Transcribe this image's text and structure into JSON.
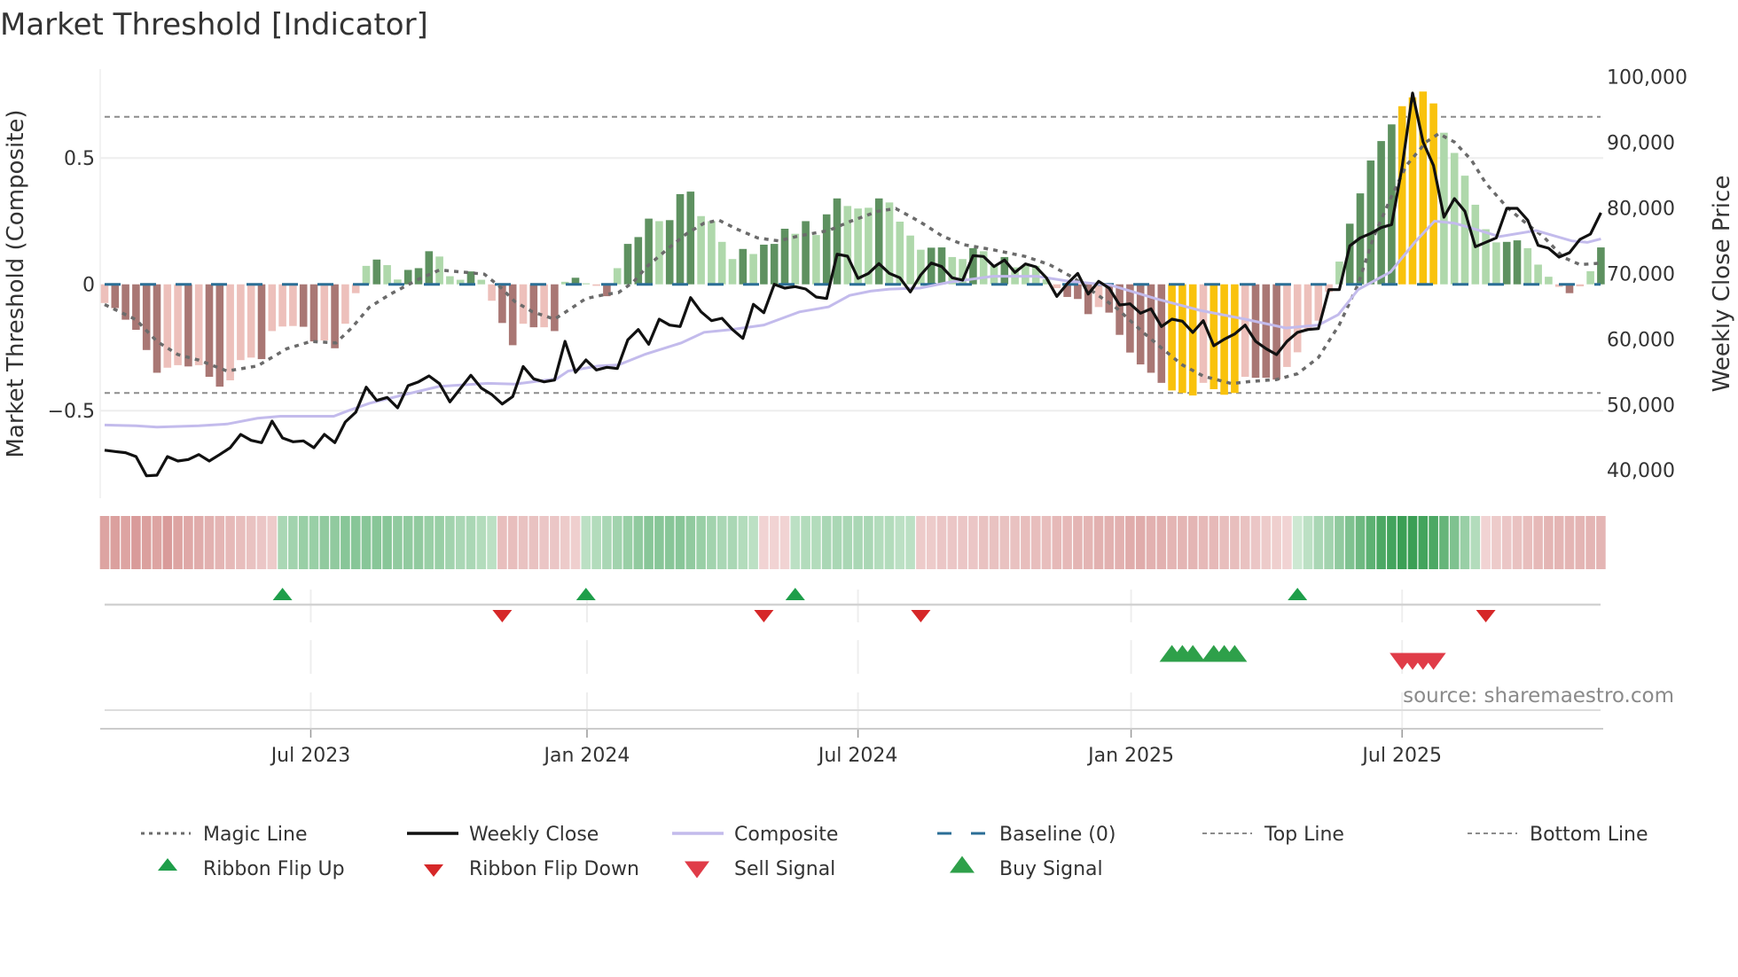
{
  "title": "Market Threshold [Indicator]",
  "source": "source: sharemaestro.com",
  "chart_data": {
    "type": "bar",
    "title": "Market Threshold [Indicator]",
    "ylabel_left": "Market Threshold (Composite)",
    "ylabel_right": "Weekly Close Price",
    "ylim_left": [
      -0.85,
      0.85
    ],
    "ylim_right": [
      35700,
      100900
    ],
    "top_line": 0.663,
    "bottom_line": -0.43,
    "baseline": 0,
    "grid": true,
    "legend_placement": "bottom",
    "x_unit": "week index",
    "x_ticks": [
      {
        "label": "Jul 2023",
        "week": 19.7
      },
      {
        "label": "Jan 2024",
        "week": 46.1
      },
      {
        "label": "Jul 2024",
        "week": 72
      },
      {
        "label": "Jan 2025",
        "week": 98.1
      },
      {
        "label": "Jul 2025",
        "week": 124
      }
    ],
    "y_left_ticks": [
      {
        "label": "0.5",
        "value": 0.5
      },
      {
        "label": "0",
        "value": 0
      },
      {
        "label": "−0.5",
        "value": -0.5
      }
    ],
    "y_right_ticks": [
      {
        "label": "100,000",
        "value": 100000
      },
      {
        "label": "90,000",
        "value": 90000
      },
      {
        "label": "80,000",
        "value": 80000
      },
      {
        "label": "70,000",
        "value": 70000
      },
      {
        "label": "60,000",
        "value": 60000
      },
      {
        "label": "50,000",
        "value": 50000
      },
      {
        "label": "40,000",
        "value": 40000
      }
    ],
    "histogram": [
      -0.074,
      -0.094,
      -0.14,
      -0.18,
      -0.26,
      -0.35,
      -0.33,
      -0.32,
      -0.325,
      -0.32,
      -0.366,
      -0.405,
      -0.38,
      -0.3,
      -0.29,
      -0.296,
      -0.185,
      -0.167,
      -0.165,
      -0.168,
      -0.226,
      -0.222,
      -0.253,
      -0.156,
      -0.035,
      0.073,
      0.098,
      0.076,
      0.019,
      0.057,
      0.064,
      0.131,
      0.11,
      0.032,
      0.018,
      0.051,
      0.018,
      -0.065,
      -0.153,
      -0.241,
      -0.156,
      -0.17,
      -0.17,
      -0.185,
      0.01,
      0.026,
      0.004,
      -0.006,
      -0.047,
      0.064,
      0.16,
      0.187,
      0.26,
      0.25,
      0.254,
      0.357,
      0.367,
      0.27,
      0.25,
      0.168,
      0.1,
      0.14,
      0.12,
      0.157,
      0.16,
      0.22,
      0.2,
      0.25,
      0.195,
      0.277,
      0.34,
      0.31,
      0.3,
      0.303,
      0.34,
      0.324,
      0.248,
      0.193,
      0.137,
      0.145,
      0.146,
      0.108,
      0.1,
      0.143,
      0.131,
      0.073,
      0.108,
      0.067,
      0.073,
      0.073,
      0.02,
      -0.015,
      -0.05,
      -0.058,
      -0.118,
      -0.09,
      -0.112,
      -0.2,
      -0.27,
      -0.317,
      -0.35,
      -0.39,
      -0.42,
      -0.43,
      -0.44,
      -0.39,
      -0.415,
      -0.437,
      -0.43,
      -0.366,
      -0.37,
      -0.37,
      -0.377,
      -0.327,
      -0.269,
      -0.179,
      -0.144,
      -0.03,
      0.09,
      0.24,
      0.36,
      0.49,
      0.567,
      0.633,
      0.705,
      0.74,
      0.763,
      0.716,
      0.6,
      0.52,
      0.43,
      0.315,
      0.218,
      0.166,
      0.168,
      0.174,
      0.143,
      0.078,
      0.03,
      -0.01,
      -0.035,
      -0.008,
      0.052,
      0.146
    ],
    "histogram_state": "rRRRRRrrRrRRrrrRrrrRRrRrrgGggGGGgggGgrRRrRrRgGgrRgGGGgGGGggggGgGGGgGgGGgggGggggGGggGggGggggrRRRrRRRRRRYYYrYYYrRRRrrrrrgGGGGGYYYYggggggGGgggrRrgG",
    "histogram_state_legend": {
      "G": "rising positive",
      "g": "falling positive",
      "R": "falling negative",
      "r": "rising negative",
      "Y": "extreme"
    },
    "weekly_close": [
      43030,
      42820,
      42640,
      42050,
      39120,
      39210,
      42050,
      41370,
      41600,
      42360,
      41370,
      42360,
      43400,
      45430,
      44530,
      44170,
      47460,
      44890,
      44310,
      44440,
      43400,
      45430,
      44170,
      47330,
      48820,
      52640,
      50610,
      51080,
      49490,
      52870,
      53460,
      54360,
      53180,
      50400,
      52430,
      54460,
      52500,
      51520,
      50080,
      51210,
      55800,
      53920,
      53460,
      53730,
      59640,
      54900,
      56800,
      55270,
      55680,
      55490,
      59870,
      61440,
      59190,
      63020,
      62120,
      61900,
      66310,
      64150,
      62790,
      63160,
      61440,
      60090,
      65280,
      64010,
      68340,
      67760,
      67990,
      67620,
      66400,
      66180,
      72940,
      72630,
      69250,
      70010,
      71500,
      70010,
      69340,
      67170,
      69790,
      71590,
      71050,
      69340,
      68970,
      72720,
      72590,
      71050,
      72050,
      70150,
      71450,
      71000,
      69340,
      66500,
      68430,
      70010,
      66850,
      68800,
      67760,
      65190,
      65360,
      63930,
      64600,
      61900,
      63020,
      62710,
      60990,
      62790,
      58960,
      59950,
      60760,
      62120,
      59640,
      58520,
      57610,
      59640,
      61000,
      61440,
      61570,
      67530,
      67530,
      74210,
      75430,
      76110,
      77000,
      77460,
      86250,
      97520,
      90080,
      86470,
      78580,
      81420,
      79490,
      74080,
      74750,
      75430,
      79930,
      79930,
      78130,
      74290,
      73850,
      72500,
      73170,
      75200,
      76010,
      79260
    ],
    "magic_line": [
      [
        0,
        -0.08
      ],
      [
        3,
        -0.14
      ],
      [
        5,
        -0.226
      ],
      [
        7,
        -0.278
      ],
      [
        9,
        -0.3
      ],
      [
        11.7,
        -0.343
      ],
      [
        14.6,
        -0.323
      ],
      [
        17.4,
        -0.255
      ],
      [
        19.7,
        -0.226
      ],
      [
        22.1,
        -0.232
      ],
      [
        23.6,
        -0.173
      ],
      [
        25.3,
        -0.091
      ],
      [
        27.3,
        -0.039
      ],
      [
        30,
        0.02
      ],
      [
        32,
        0.057
      ],
      [
        34.6,
        0.047
      ],
      [
        36.3,
        0.04
      ],
      [
        37.8,
        -0.01
      ],
      [
        39.2,
        -0.068
      ],
      [
        40.9,
        -0.109
      ],
      [
        43,
        -0.138
      ],
      [
        44.3,
        -0.103
      ],
      [
        46,
        -0.056
      ],
      [
        48,
        -0.039
      ],
      [
        49.1,
        -0.033
      ],
      [
        50.5,
        0.008
      ],
      [
        51.9,
        0.073
      ],
      [
        53.9,
        0.143
      ],
      [
        55.6,
        0.2
      ],
      [
        57.3,
        0.242
      ],
      [
        58.7,
        0.254
      ],
      [
        60.4,
        0.219
      ],
      [
        62.4,
        0.184
      ],
      [
        64.4,
        0.172
      ],
      [
        66.4,
        0.192
      ],
      [
        69.2,
        0.213
      ],
      [
        71.2,
        0.248
      ],
      [
        73.9,
        0.289
      ],
      [
        75.6,
        0.3
      ],
      [
        77.9,
        0.248
      ],
      [
        80.1,
        0.19
      ],
      [
        82.1,
        0.157
      ],
      [
        84.9,
        0.137
      ],
      [
        88,
        0.11
      ],
      [
        90.3,
        0.078
      ],
      [
        92.6,
        0.026
      ],
      [
        94.8,
        -0.039
      ],
      [
        96.8,
        -0.097
      ],
      [
        99.1,
        -0.185
      ],
      [
        101.1,
        -0.255
      ],
      [
        103,
        -0.319
      ],
      [
        105,
        -0.363
      ],
      [
        107.7,
        -0.393
      ],
      [
        109.4,
        -0.385
      ],
      [
        112,
        -0.377
      ],
      [
        114,
        -0.354
      ],
      [
        116,
        -0.29
      ],
      [
        118,
        -0.16
      ],
      [
        119.8,
        0
      ],
      [
        121.3,
        0.19
      ],
      [
        122.9,
        0.34
      ],
      [
        124.4,
        0.47
      ],
      [
        126.3,
        0.563
      ],
      [
        127.5,
        0.596
      ],
      [
        129,
        0.563
      ],
      [
        130.6,
        0.493
      ],
      [
        132,
        0.4
      ],
      [
        134,
        0.306
      ],
      [
        136,
        0.236
      ],
      [
        137.5,
        0.189
      ],
      [
        139.4,
        0.107
      ],
      [
        141,
        0.078
      ],
      [
        143,
        0.084
      ]
    ],
    "composite": [
      [
        0,
        -0.557
      ],
      [
        3,
        -0.56
      ],
      [
        5,
        -0.565
      ],
      [
        9,
        -0.56
      ],
      [
        11.7,
        -0.553
      ],
      [
        14.6,
        -0.53
      ],
      [
        16.8,
        -0.522
      ],
      [
        21.9,
        -0.522
      ],
      [
        23.3,
        -0.5
      ],
      [
        25.3,
        -0.471
      ],
      [
        28.7,
        -0.436
      ],
      [
        32,
        -0.404
      ],
      [
        36.6,
        -0.392
      ],
      [
        39.2,
        -0.395
      ],
      [
        43.2,
        -0.374
      ],
      [
        44.3,
        -0.343
      ],
      [
        47.2,
        -0.323
      ],
      [
        49.1,
        -0.319
      ],
      [
        51.7,
        -0.276
      ],
      [
        55.1,
        -0.232
      ],
      [
        57.3,
        -0.19
      ],
      [
        59.9,
        -0.179
      ],
      [
        63,
        -0.161
      ],
      [
        66.4,
        -0.109
      ],
      [
        69.2,
        -0.089
      ],
      [
        71.2,
        -0.044
      ],
      [
        73.2,
        -0.027
      ],
      [
        75,
        -0.019
      ],
      [
        77.9,
        -0.015
      ],
      [
        80.7,
        0.008
      ],
      [
        84.9,
        0.032
      ],
      [
        89.1,
        0.032
      ],
      [
        91.9,
        0.014
      ],
      [
        96.2,
        -0.004
      ],
      [
        100.4,
        -0.056
      ],
      [
        104.7,
        -0.103
      ],
      [
        109,
        -0.138
      ],
      [
        112.9,
        -0.173
      ],
      [
        116,
        -0.161
      ],
      [
        117.9,
        -0.12
      ],
      [
        119.8,
        -0.021
      ],
      [
        122.9,
        0.049
      ],
      [
        125.2,
        0.166
      ],
      [
        127.1,
        0.25
      ],
      [
        129,
        0.242
      ],
      [
        131,
        0.218
      ],
      [
        133.3,
        0.189
      ],
      [
        136.8,
        0.213
      ],
      [
        140.2,
        0.172
      ],
      [
        141.7,
        0.166
      ],
      [
        143,
        0.18
      ]
    ],
    "ribbon": [
      -0.7,
      -0.75,
      -0.7,
      -0.8,
      -0.75,
      -0.7,
      -0.8,
      -0.7,
      -0.65,
      -0.6,
      -0.55,
      -0.5,
      -0.45,
      -0.4,
      -0.35,
      -0.3,
      -0.25,
      0.3,
      0.35,
      0.4,
      0.4,
      0.45,
      0.45,
      0.5,
      0.5,
      0.5,
      0.5,
      0.5,
      0.45,
      0.45,
      0.45,
      0.4,
      0.4,
      0.35,
      0.3,
      0.3,
      0.25,
      0.2,
      -0.4,
      -0.4,
      -0.35,
      -0.35,
      -0.3,
      -0.3,
      -0.25,
      -0.2,
      0.2,
      0.25,
      0.3,
      0.35,
      0.4,
      0.45,
      0.5,
      0.5,
      0.5,
      0.5,
      0.45,
      0.4,
      0.35,
      0.3,
      0.3,
      0.25,
      0.2,
      -0.15,
      -0.15,
      -0.15,
      0.2,
      0.25,
      0.25,
      0.3,
      0.3,
      0.3,
      0.3,
      0.3,
      0.25,
      0.25,
      0.2,
      0.2,
      -0.25,
      -0.25,
      -0.3,
      -0.3,
      -0.3,
      -0.3,
      -0.35,
      -0.35,
      -0.35,
      -0.35,
      -0.4,
      -0.4,
      -0.4,
      -0.45,
      -0.45,
      -0.5,
      -0.5,
      -0.55,
      -0.55,
      -0.55,
      -0.6,
      -0.6,
      -0.55,
      -0.55,
      -0.5,
      -0.5,
      -0.5,
      -0.45,
      -0.45,
      -0.4,
      -0.4,
      -0.35,
      -0.3,
      -0.25,
      -0.2,
      -0.15,
      0.1,
      0.2,
      0.3,
      0.35,
      0.45,
      0.55,
      0.65,
      0.75,
      0.85,
      0.9,
      0.95,
      0.95,
      0.9,
      0.85,
      0.7,
      0.55,
      0.4,
      0.25,
      -0.15,
      -0.25,
      -0.3,
      -0.35,
      -0.4,
      -0.45,
      -0.5,
      -0.5,
      -0.5,
      -0.5,
      -0.5,
      -0.5
    ],
    "ribbon_flip_up": [
      17,
      46,
      66,
      114
    ],
    "ribbon_flip_down": [
      38,
      63,
      78,
      132
    ],
    "buy_signals": [
      102,
      103,
      104,
      106,
      107,
      108
    ],
    "sell_signals": [
      124,
      125,
      126,
      127
    ],
    "legend": [
      {
        "label": "Magic Line",
        "symbol": "dotted-line"
      },
      {
        "label": "Weekly Close",
        "symbol": "solid-line"
      },
      {
        "label": "Composite",
        "symbol": "lavender-line"
      },
      {
        "label": "Baseline (0)",
        "symbol": "dashed-blue-line"
      },
      {
        "label": "Top Line",
        "symbol": "thin-dotted-line"
      },
      {
        "label": "Bottom Line",
        "symbol": "thin-dotted-line"
      },
      {
        "label": "Ribbon Flip Up",
        "symbol": "small-up-triangle"
      },
      {
        "label": "Ribbon Flip Down",
        "symbol": "small-down-triangle"
      },
      {
        "label": "Sell Signal",
        "symbol": "down-triangle"
      },
      {
        "label": "Buy Signal",
        "symbol": "up-triangle"
      }
    ],
    "colors": {
      "G": "#5e9160",
      "g": "#afd8ab",
      "R": "#a97774",
      "r": "#edc0bb",
      "Y": "#f9c20c",
      "close": "#111111",
      "composite": "#c3bbec",
      "magic": "#6b6b6b",
      "baseline": "#2b6e96",
      "threshold": "#8c8c8c",
      "flip_up": "#1e9e4a",
      "flip_down": "#d62728",
      "buy": "#2ea04a",
      "sell": "#e03c48"
    }
  }
}
